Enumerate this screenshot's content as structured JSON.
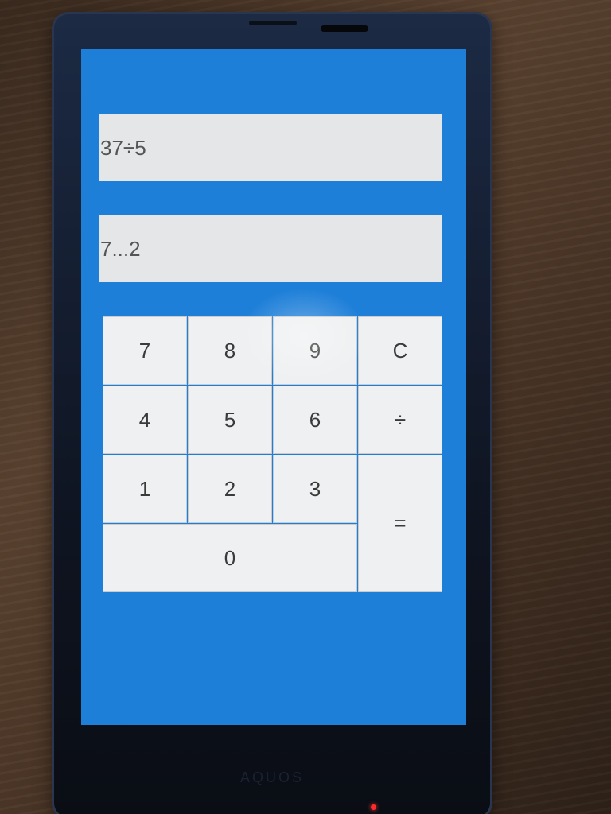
{
  "device": {
    "brand": "AQUOS"
  },
  "calculator": {
    "expression": "37÷5",
    "result": "7...2",
    "keys": {
      "k7": "7",
      "k8": "8",
      "k9": "9",
      "clear": "C",
      "k4": "4",
      "k5": "5",
      "k6": "6",
      "divide": "÷",
      "k1": "1",
      "k2": "2",
      "k3": "3",
      "equals": "=",
      "k0": "0"
    }
  },
  "colors": {
    "screen_background": "#1e7fd8",
    "display_background": "#e4e6e8",
    "key_background": "#eef0f1",
    "led": "#ff2a2a"
  }
}
